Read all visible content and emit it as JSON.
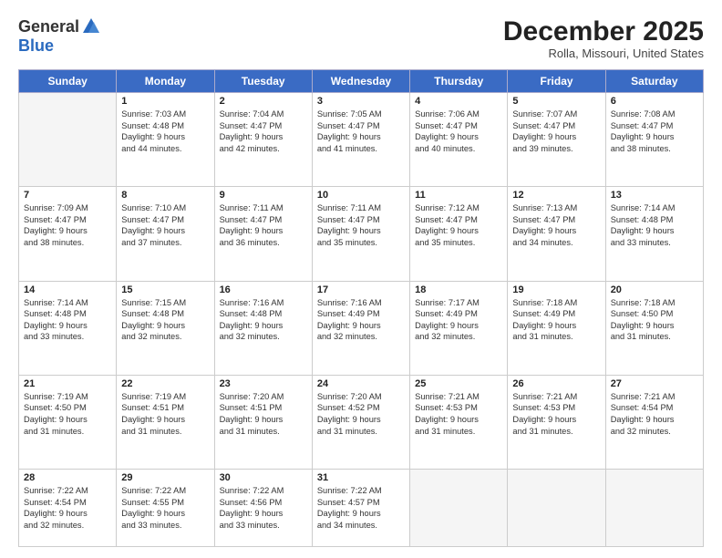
{
  "logo": {
    "general": "General",
    "blue": "Blue"
  },
  "header": {
    "month_title": "December 2025",
    "location": "Rolla, Missouri, United States"
  },
  "days_of_week": [
    "Sunday",
    "Monday",
    "Tuesday",
    "Wednesday",
    "Thursday",
    "Friday",
    "Saturday"
  ],
  "weeks": [
    [
      {
        "day": "",
        "empty": true
      },
      {
        "day": "1",
        "sunrise": "Sunrise: 7:03 AM",
        "sunset": "Sunset: 4:48 PM",
        "daylight": "Daylight: 9 hours and 44 minutes."
      },
      {
        "day": "2",
        "sunrise": "Sunrise: 7:04 AM",
        "sunset": "Sunset: 4:47 PM",
        "daylight": "Daylight: 9 hours and 42 minutes."
      },
      {
        "day": "3",
        "sunrise": "Sunrise: 7:05 AM",
        "sunset": "Sunset: 4:47 PM",
        "daylight": "Daylight: 9 hours and 41 minutes."
      },
      {
        "day": "4",
        "sunrise": "Sunrise: 7:06 AM",
        "sunset": "Sunset: 4:47 PM",
        "daylight": "Daylight: 9 hours and 40 minutes."
      },
      {
        "day": "5",
        "sunrise": "Sunrise: 7:07 AM",
        "sunset": "Sunset: 4:47 PM",
        "daylight": "Daylight: 9 hours and 39 minutes."
      },
      {
        "day": "6",
        "sunrise": "Sunrise: 7:08 AM",
        "sunset": "Sunset: 4:47 PM",
        "daylight": "Daylight: 9 hours and 38 minutes."
      }
    ],
    [
      {
        "day": "7",
        "sunrise": "Sunrise: 7:09 AM",
        "sunset": "Sunset: 4:47 PM",
        "daylight": "Daylight: 9 hours and 38 minutes."
      },
      {
        "day": "8",
        "sunrise": "Sunrise: 7:10 AM",
        "sunset": "Sunset: 4:47 PM",
        "daylight": "Daylight: 9 hours and 37 minutes."
      },
      {
        "day": "9",
        "sunrise": "Sunrise: 7:11 AM",
        "sunset": "Sunset: 4:47 PM",
        "daylight": "Daylight: 9 hours and 36 minutes."
      },
      {
        "day": "10",
        "sunrise": "Sunrise: 7:11 AM",
        "sunset": "Sunset: 4:47 PM",
        "daylight": "Daylight: 9 hours and 35 minutes."
      },
      {
        "day": "11",
        "sunrise": "Sunrise: 7:12 AM",
        "sunset": "Sunset: 4:47 PM",
        "daylight": "Daylight: 9 hours and 35 minutes."
      },
      {
        "day": "12",
        "sunrise": "Sunrise: 7:13 AM",
        "sunset": "Sunset: 4:47 PM",
        "daylight": "Daylight: 9 hours and 34 minutes."
      },
      {
        "day": "13",
        "sunrise": "Sunrise: 7:14 AM",
        "sunset": "Sunset: 4:48 PM",
        "daylight": "Daylight: 9 hours and 33 minutes."
      }
    ],
    [
      {
        "day": "14",
        "sunrise": "Sunrise: 7:14 AM",
        "sunset": "Sunset: 4:48 PM",
        "daylight": "Daylight: 9 hours and 33 minutes."
      },
      {
        "day": "15",
        "sunrise": "Sunrise: 7:15 AM",
        "sunset": "Sunset: 4:48 PM",
        "daylight": "Daylight: 9 hours and 32 minutes."
      },
      {
        "day": "16",
        "sunrise": "Sunrise: 7:16 AM",
        "sunset": "Sunset: 4:48 PM",
        "daylight": "Daylight: 9 hours and 32 minutes."
      },
      {
        "day": "17",
        "sunrise": "Sunrise: 7:16 AM",
        "sunset": "Sunset: 4:49 PM",
        "daylight": "Daylight: 9 hours and 32 minutes."
      },
      {
        "day": "18",
        "sunrise": "Sunrise: 7:17 AM",
        "sunset": "Sunset: 4:49 PM",
        "daylight": "Daylight: 9 hours and 32 minutes."
      },
      {
        "day": "19",
        "sunrise": "Sunrise: 7:18 AM",
        "sunset": "Sunset: 4:49 PM",
        "daylight": "Daylight: 9 hours and 31 minutes."
      },
      {
        "day": "20",
        "sunrise": "Sunrise: 7:18 AM",
        "sunset": "Sunset: 4:50 PM",
        "daylight": "Daylight: 9 hours and 31 minutes."
      }
    ],
    [
      {
        "day": "21",
        "sunrise": "Sunrise: 7:19 AM",
        "sunset": "Sunset: 4:50 PM",
        "daylight": "Daylight: 9 hours and 31 minutes."
      },
      {
        "day": "22",
        "sunrise": "Sunrise: 7:19 AM",
        "sunset": "Sunset: 4:51 PM",
        "daylight": "Daylight: 9 hours and 31 minutes."
      },
      {
        "day": "23",
        "sunrise": "Sunrise: 7:20 AM",
        "sunset": "Sunset: 4:51 PM",
        "daylight": "Daylight: 9 hours and 31 minutes."
      },
      {
        "day": "24",
        "sunrise": "Sunrise: 7:20 AM",
        "sunset": "Sunset: 4:52 PM",
        "daylight": "Daylight: 9 hours and 31 minutes."
      },
      {
        "day": "25",
        "sunrise": "Sunrise: 7:21 AM",
        "sunset": "Sunset: 4:53 PM",
        "daylight": "Daylight: 9 hours and 31 minutes."
      },
      {
        "day": "26",
        "sunrise": "Sunrise: 7:21 AM",
        "sunset": "Sunset: 4:53 PM",
        "daylight": "Daylight: 9 hours and 31 minutes."
      },
      {
        "day": "27",
        "sunrise": "Sunrise: 7:21 AM",
        "sunset": "Sunset: 4:54 PM",
        "daylight": "Daylight: 9 hours and 32 minutes."
      }
    ],
    [
      {
        "day": "28",
        "sunrise": "Sunrise: 7:22 AM",
        "sunset": "Sunset: 4:54 PM",
        "daylight": "Daylight: 9 hours and 32 minutes."
      },
      {
        "day": "29",
        "sunrise": "Sunrise: 7:22 AM",
        "sunset": "Sunset: 4:55 PM",
        "daylight": "Daylight: 9 hours and 33 minutes."
      },
      {
        "day": "30",
        "sunrise": "Sunrise: 7:22 AM",
        "sunset": "Sunset: 4:56 PM",
        "daylight": "Daylight: 9 hours and 33 minutes."
      },
      {
        "day": "31",
        "sunrise": "Sunrise: 7:22 AM",
        "sunset": "Sunset: 4:57 PM",
        "daylight": "Daylight: 9 hours and 34 minutes."
      },
      {
        "day": "",
        "empty": true
      },
      {
        "day": "",
        "empty": true
      },
      {
        "day": "",
        "empty": true
      }
    ]
  ]
}
